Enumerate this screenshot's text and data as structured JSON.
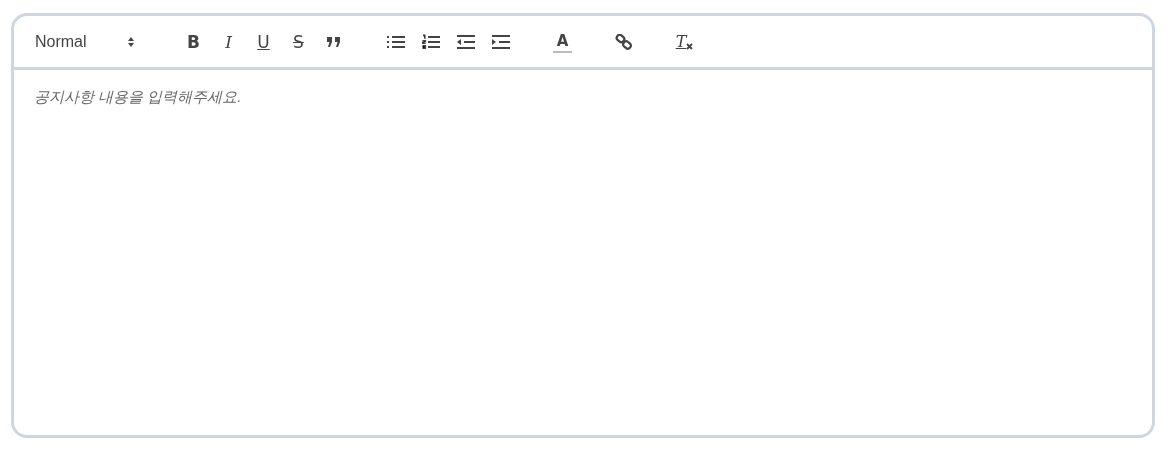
{
  "toolbar": {
    "format": {
      "value": "Normal"
    },
    "groups": [
      [
        {
          "kind": "bold",
          "label": "B"
        },
        {
          "kind": "italic",
          "label": "I"
        },
        {
          "kind": "underline",
          "label": "U"
        },
        {
          "kind": "strike",
          "label": "S"
        },
        {
          "kind": "blockquote"
        }
      ],
      [
        {
          "kind": "bullet-list"
        },
        {
          "kind": "ordered-list"
        },
        {
          "kind": "outdent"
        },
        {
          "kind": "indent"
        }
      ],
      [
        {
          "kind": "color",
          "label": "A"
        }
      ],
      [
        {
          "kind": "link"
        }
      ],
      [
        {
          "kind": "clean",
          "label": "T"
        }
      ]
    ]
  },
  "editor": {
    "placeholder": "공지사항 내용을 입력해주세요."
  }
}
